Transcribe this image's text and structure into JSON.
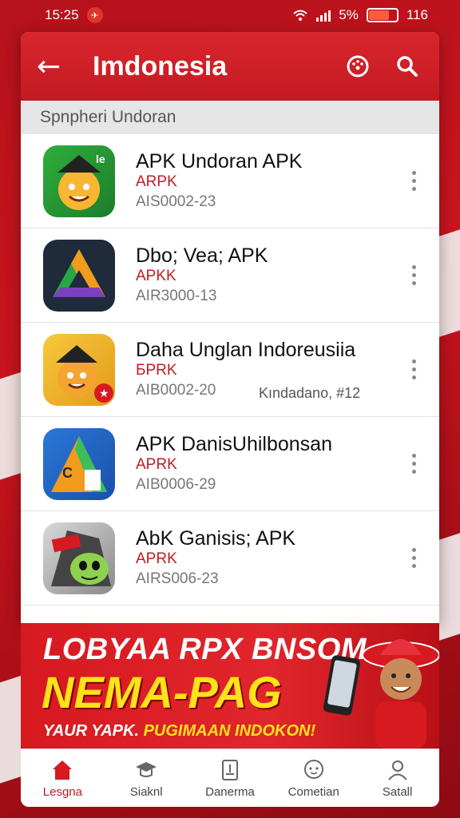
{
  "status_bar": {
    "time": "15:25",
    "battery_percent": "5%",
    "right_value": "116"
  },
  "app_bar": {
    "title": "Imdonesia",
    "back_icon": "arrow-left-icon",
    "settings_icon": "gauge-icon",
    "search_icon": "search-icon"
  },
  "section": {
    "header": "Spnpheri Undoran"
  },
  "apps": [
    {
      "name": "APK Undoran APK",
      "type": "ARPK",
      "code": "AIS0002-23",
      "extra": ""
    },
    {
      "name": "Dbo; Vea; APK",
      "type": "APKK",
      "code": "AIR3000-13",
      "extra": ""
    },
    {
      "name": "Daha Unglan Indoreusiia",
      "type": "БPRK",
      "code": "AIB0002-20",
      "extra": "Kındadano, #12"
    },
    {
      "name": "APK DanisUhilbonsan",
      "type": "APRK",
      "code": "AIB0006-29",
      "extra": ""
    },
    {
      "name": "AbK Ganisis; APK",
      "type": "APRK",
      "code": "AIRS006-23",
      "extra": ""
    }
  ],
  "banner": {
    "line1": "LOBYAA RPX BNSOM",
    "line2": "NEMA-PAG",
    "line3_a": "YAUR YAPK.",
    "line3_b": "PUGIMAAN INDOKON!"
  },
  "bottom_nav": [
    {
      "label": "Lesgna",
      "icon": "home-icon",
      "active": true
    },
    {
      "label": "Siaknl",
      "icon": "graduation-cap-icon",
      "active": false
    },
    {
      "label": "Danerma",
      "icon": "document-icon",
      "active": false
    },
    {
      "label": "Cometian",
      "icon": "chat-icon",
      "active": false
    },
    {
      "label": "Satall",
      "icon": "user-icon",
      "active": false
    }
  ],
  "colors": {
    "primary": "#c41a22",
    "accent_yellow": "#ffe21a"
  }
}
